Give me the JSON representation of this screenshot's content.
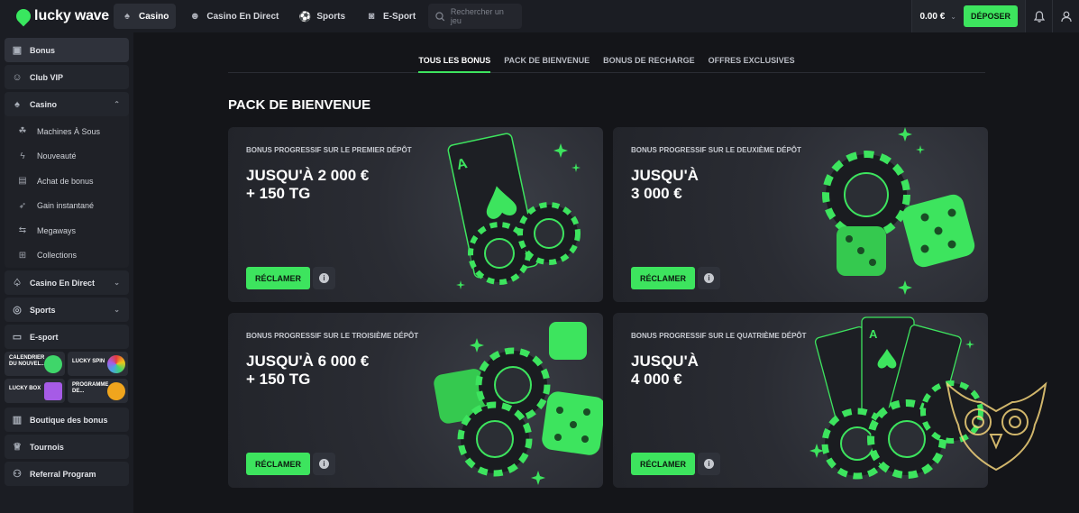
{
  "header": {
    "logo": {
      "part1": "lucky",
      "part2": "wave"
    },
    "nav": [
      {
        "label": "Casino",
        "icon": "spade-icon",
        "active": true
      },
      {
        "label": "Casino En Direct",
        "icon": "dealer-icon",
        "active": false
      },
      {
        "label": "Sports",
        "icon": "ball-icon",
        "active": false
      },
      {
        "label": "E-Sport",
        "icon": "gamepad-icon",
        "active": false
      }
    ],
    "search": {
      "placeholder": "Rechercher un jeu"
    },
    "balance": "0.00 €",
    "deposit_label": "DÉPOSER"
  },
  "sidebar": {
    "top_items": [
      {
        "label": "Bonus",
        "icon": "gift-icon"
      },
      {
        "label": "Club VIP",
        "icon": "user-icon"
      }
    ],
    "casino": {
      "label": "Casino",
      "icon": "spade-icon",
      "children": [
        {
          "label": "Machines À Sous",
          "icon": "slots-icon"
        },
        {
          "label": "Nouveauté",
          "icon": "flash-icon"
        },
        {
          "label": "Achat de bonus",
          "icon": "bag-icon"
        },
        {
          "label": "Gain instantané",
          "icon": "rocket-icon"
        },
        {
          "label": "Megaways",
          "icon": "arrows-icon"
        },
        {
          "label": "Collections",
          "icon": "grid-icon"
        }
      ]
    },
    "mid_items": [
      {
        "label": "Casino En Direct",
        "icon": "dealer-icon"
      },
      {
        "label": "Sports",
        "icon": "ball-icon"
      },
      {
        "label": "E-sport",
        "icon": "gamepad-icon"
      }
    ],
    "promos": [
      {
        "line1": "CALENDRIER",
        "line2": "DU NOUVEL...",
        "color": "#3fd66a"
      },
      {
        "line1": "LUCKY SPIN",
        "line2": "",
        "color": "#4aa3e6"
      },
      {
        "line1": "LUCKY BOX",
        "line2": "",
        "color": "#a65be6"
      },
      {
        "line1": "PROGRAMME",
        "line2": "DE...",
        "color": "#f0a51d"
      }
    ],
    "bottom_items": [
      {
        "label": "Boutique des bonus",
        "icon": "shop-icon"
      },
      {
        "label": "Tournois",
        "icon": "trophy-icon"
      },
      {
        "label": "Referral Program",
        "icon": "referral-icon"
      }
    ]
  },
  "main": {
    "tabs": [
      "TOUS LES BONUS",
      "PACK DE BIENVENUE",
      "BONUS DE RECHARGE",
      "OFFRES EXCLUSIVES"
    ],
    "section_title": "PACK DE BIENVENUE",
    "cards": [
      {
        "label": "BONUS PROGRESSIF SUR LE PREMIER DÉPÔT",
        "amount": "JUSQU'À 2 000 €\n+ 150 TG",
        "claim": "RÉCLAMER"
      },
      {
        "label": "BONUS PROGRESSIF SUR LE DEUXIÈME DÉPÔT",
        "amount": "JUSQU'À\n3 000 €",
        "claim": "RÉCLAMER"
      },
      {
        "label": "BONUS PROGRESSIF SUR LE TROISIÈME DÉPÔT",
        "amount": "JUSQU'À 6 000 €\n+ 150 TG",
        "claim": "RÉCLAMER"
      },
      {
        "label": "BONUS PROGRESSIF SUR LE QUATRIÈME DÉPÔT",
        "amount": "JUSQU'À\n4 000 €",
        "claim": "RÉCLAMER"
      }
    ]
  },
  "colors": {
    "accent": "#3de45e",
    "bg": "#141519",
    "sidebar": "#1b1d23"
  }
}
